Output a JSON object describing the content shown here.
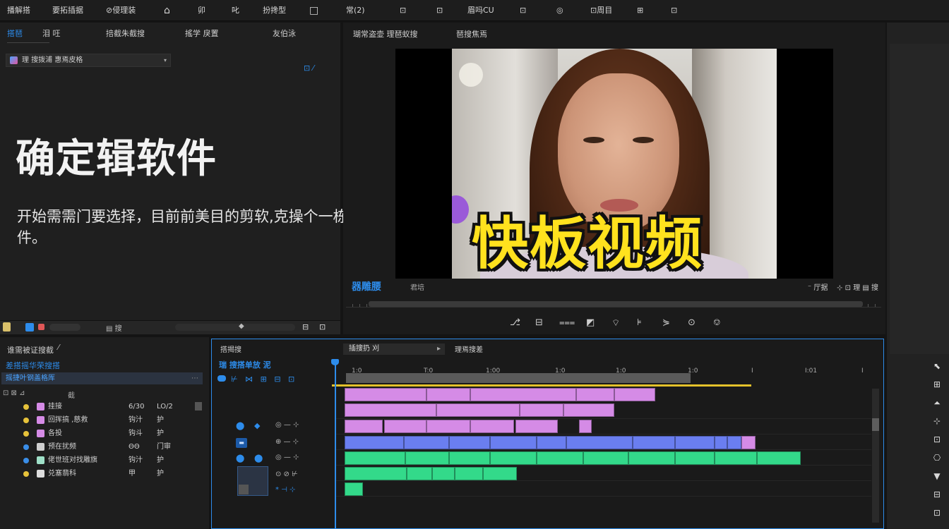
{
  "menubar": {
    "items": [
      "播解搭",
      "要拓插据",
      "⊘侵理装",
      "⌂",
      "卯",
      "叱",
      "扮搀型",
      "□",
      "常(2)",
      "⊡",
      "⊡",
      "眉吗CU",
      "⊡",
      "◎",
      "⊡周目",
      "⊞",
      "⊡"
    ]
  },
  "project": {
    "tabs": [
      "搭琶",
      "泪 㕵",
      "掊截朱截搜",
      "搖学 戾置",
      "友伯泳"
    ],
    "dropdown_label": "理 搜拨浦 惠焉皮格",
    "headline": "确定辑软件",
    "subline": "开始需需门要选择，目前前美目的剪软,克操个一栋让辖件。"
  },
  "program": {
    "tabs": [
      "瑚常盗壶 理琶蚁搜",
      "琶搜焦焉"
    ],
    "overlay_text": "快板视频",
    "timecode": "器雕腰",
    "fit": "君培",
    "right_label": "厅据"
  },
  "effects": {
    "title": "谁需被证搜截",
    "link": "差搭摇华荣搜搭",
    "selected": "摇捷叶钢盖格厍",
    "header": "截",
    "rows": [
      {
        "name": "挂接",
        "c1": "6/30",
        "c2": "LO/2",
        "color": "#e6c23a",
        "thumb": "#d58be6"
      },
      {
        "name": "回挥搞 ,慈救",
        "c1": "钩汁",
        "c2": "护",
        "color": "#e6c23a",
        "thumb": "#d58be6"
      },
      {
        "name": "各投",
        "c1": "钩斗",
        "c2": "护",
        "color": "#e6c23a",
        "thumb": "#d58be6"
      },
      {
        "name": "预在扰频",
        "c1": "ΘΘ",
        "c2": "门审",
        "color": "#3a8ee8",
        "thumb": "#cfcfcf"
      },
      {
        "name": "佬世班对找雕旗",
        "c1": "钩汁",
        "c2": "护",
        "color": "#3a8ee8",
        "thumb": "#9fe0c8"
      },
      {
        "name": "兑塞翡科",
        "c1": "甲",
        "c2": "护",
        "color": "#e6c23a",
        "thumb": "#ddd"
      }
    ]
  },
  "timeline": {
    "tab": "搭揭搜",
    "sequence": "插搜扔 刈",
    "tab2": "理焉搜差",
    "timecode": "瑞 搜搭单放 泥",
    "ruler_labels": [
      "1:0",
      "T:0",
      "1:00",
      "1:0",
      "1:0",
      "1:0",
      "1:0",
      "I",
      "I:01",
      "I"
    ]
  }
}
